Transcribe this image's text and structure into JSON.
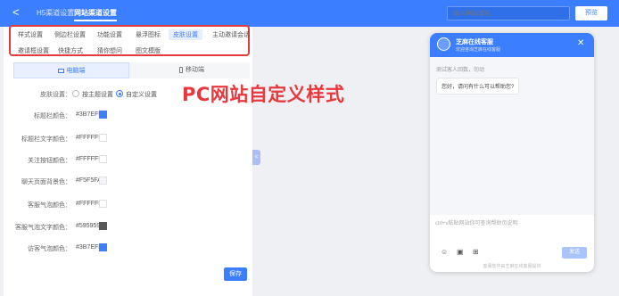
{
  "header": {
    "back_glyph": "<",
    "tabs": [
      {
        "label": "H5渠道设置",
        "active": false
      },
      {
        "label": "网站渠道设置",
        "active": true
      }
    ],
    "search_placeholder": "输入网站域名",
    "preview_label": "预览"
  },
  "menu": {
    "row1": [
      {
        "label": "样式设置",
        "active": false
      },
      {
        "label": "侧边栏设置",
        "active": false
      },
      {
        "label": "功能设置",
        "active": false
      },
      {
        "label": "悬浮图标",
        "active": false
      },
      {
        "label": "皮肤设置",
        "active": true
      },
      {
        "label": "主动邀请会话",
        "active": false
      }
    ],
    "row2": [
      {
        "label": "邀请框设置",
        "active": false
      },
      {
        "label": "快捷方式",
        "active": false
      },
      {
        "label": "猜你想问",
        "active": false
      },
      {
        "label": "图文模版",
        "active": false
      }
    ]
  },
  "device_tabs": [
    {
      "label": "电脑端",
      "icon": "monitor-icon",
      "active": true
    },
    {
      "label": "移动端",
      "icon": "mobile-icon",
      "active": false
    }
  ],
  "skin": {
    "label": "皮肤设置：",
    "options": [
      {
        "label": "按主题设置",
        "selected": false
      },
      {
        "label": "自定义设置",
        "selected": true
      }
    ]
  },
  "colors": [
    {
      "label": "标题栏颜色：",
      "hex": "#3B7EFF",
      "swatch": "#3B7EFF"
    },
    {
      "label": "标题栏文字颜色：",
      "hex": "#FFFFFF",
      "swatch": "#FFFFFF"
    },
    {
      "label": "关注按钮颜色：",
      "hex": "#FFFFFF",
      "swatch": "#FFFFFF"
    },
    {
      "label": "聊天页面背景色：",
      "hex": "#F5F5FA",
      "swatch": "#F5F5FA"
    },
    {
      "label": "客服气泡颜色：",
      "hex": "#FFFFFF",
      "swatch": "#FFFFFF"
    },
    {
      "label": "客服气泡文字颜色：",
      "hex": "#595959",
      "swatch": "#595959"
    },
    {
      "label": "访客气泡颜色：",
      "hex": "#3B7EFF",
      "swatch": "#3B7EFF"
    }
  ],
  "save_label": "保存",
  "annotation": "PC网站自定义样式",
  "collapse_glyph": "<",
  "chat": {
    "title": "芝麻在线客服",
    "subtitle": "欢迎咨询芝麻在线客服",
    "close_glyph": "✕",
    "hint": "测试客人回数，勿动",
    "bubble": "您好，请问有什么可以帮助您?",
    "input_placeholder": "ctrl+v粘贴网站你可查询帮助页说明",
    "tools": [
      {
        "icon": "emoji-icon",
        "glyph": "☺"
      },
      {
        "icon": "image-icon",
        "glyph": "▣"
      },
      {
        "icon": "file-icon",
        "glyph": "⊞"
      }
    ],
    "send_label": "发送",
    "powered": "客服软件由芝麻在线客服提供"
  },
  "accent_color": "#3B7EFF"
}
